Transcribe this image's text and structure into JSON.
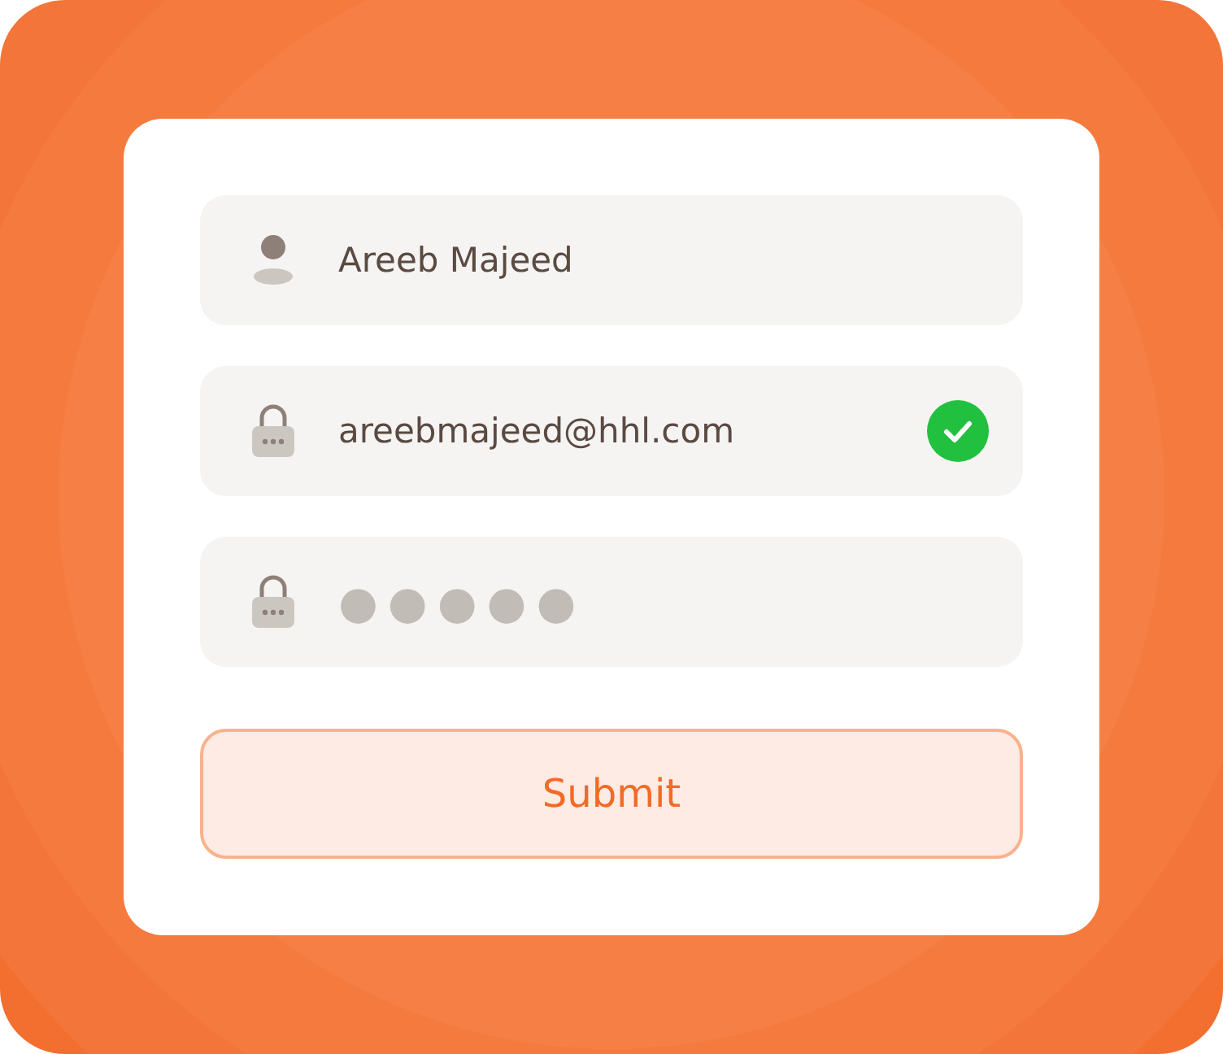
{
  "fields": [
    {
      "kind": "name",
      "value": "Areeb Majeed",
      "valid": false
    },
    {
      "kind": "email",
      "value": "areebmajeed@hhl.com",
      "valid": true
    },
    {
      "kind": "password",
      "value": "●●●●●",
      "valid": false
    }
  ],
  "submit": {
    "label": "Submit"
  }
}
